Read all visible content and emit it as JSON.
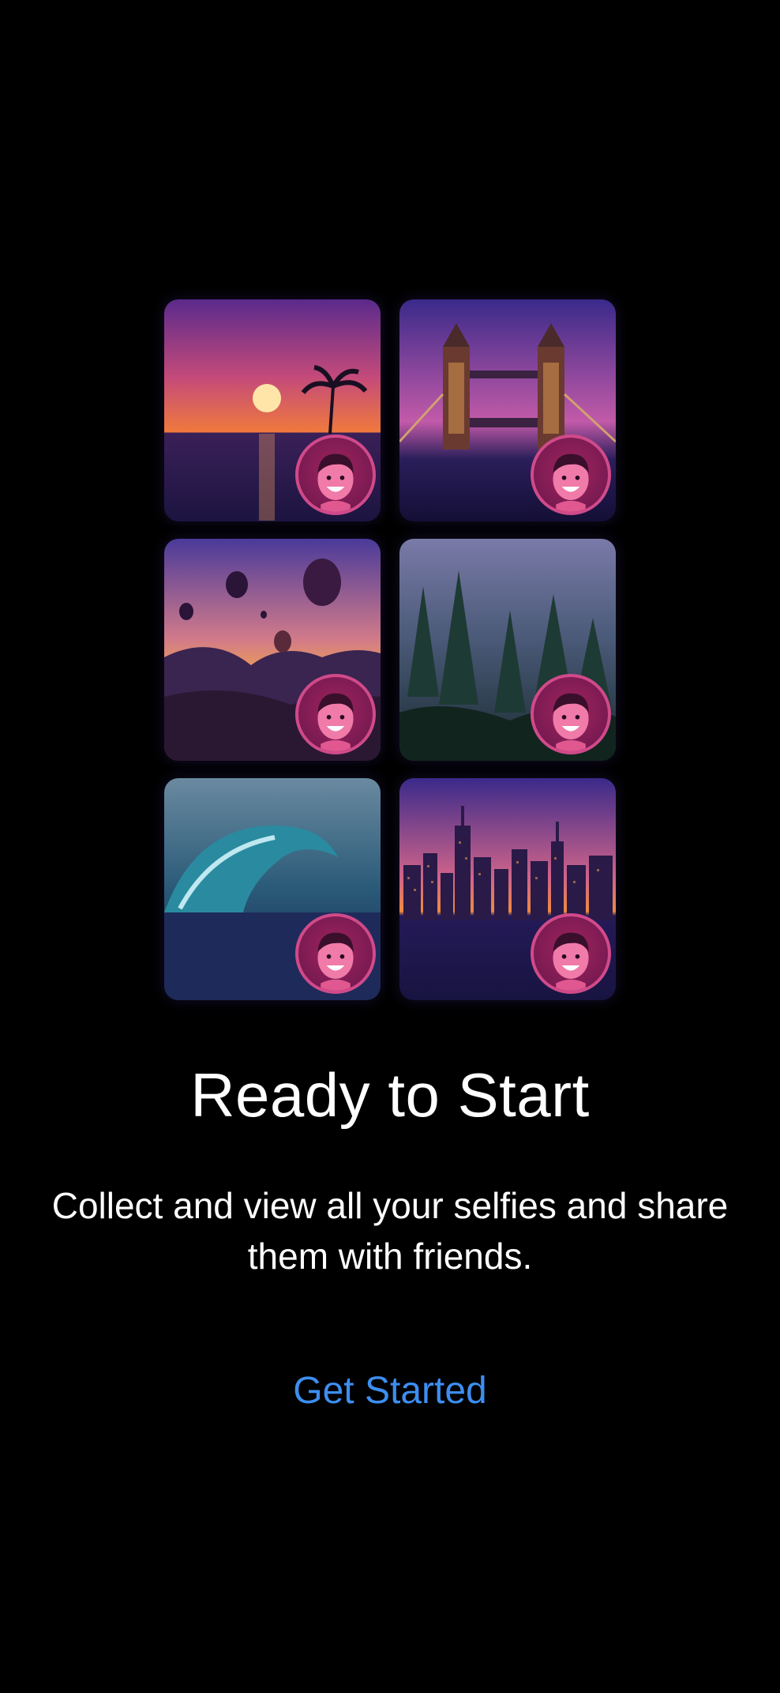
{
  "onboarding": {
    "title": "Ready to Start",
    "subtitle": "Collect and view all your selfies and share them with friends.",
    "cta_label": "Get Started"
  },
  "gallery": {
    "tiles": [
      {
        "scene": "sunset-palm",
        "badge_icon": "avatar-face-icon"
      },
      {
        "scene": "tower-bridge",
        "badge_icon": "avatar-face-icon"
      },
      {
        "scene": "hot-air-balloons",
        "badge_icon": "avatar-face-icon"
      },
      {
        "scene": "misty-forest",
        "badge_icon": "avatar-face-icon"
      },
      {
        "scene": "ocean-wave",
        "badge_icon": "avatar-face-icon"
      },
      {
        "scene": "city-skyline",
        "badge_icon": "avatar-face-icon"
      }
    ]
  },
  "colors": {
    "background": "#000000",
    "text": "#ffffff",
    "accent": "#3d8ef0",
    "badge": "#a0245e"
  }
}
